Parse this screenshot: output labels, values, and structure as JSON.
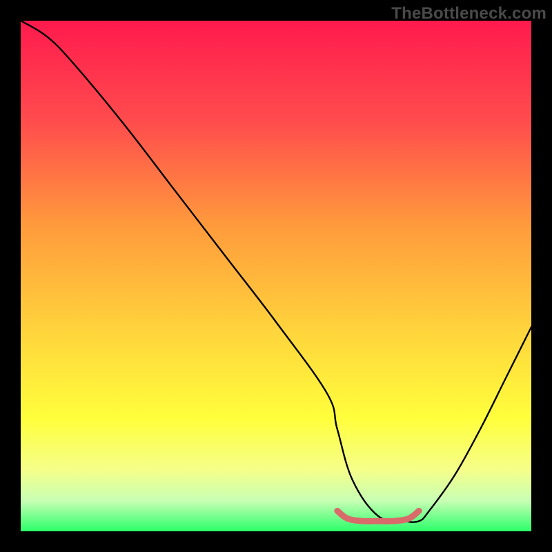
{
  "watermark": "TheBottleneck.com",
  "chart_data": {
    "type": "line",
    "title": "",
    "xlabel": "",
    "ylabel": "",
    "xlim": [
      0,
      100
    ],
    "ylim": [
      0,
      100
    ],
    "grid": false,
    "series": [
      {
        "name": "bottleneck-curve",
        "color": "#000000",
        "x": [
          0,
          5,
          10,
          20,
          30,
          40,
          50,
          60,
          62,
          65,
          70,
          75,
          78,
          80,
          85,
          90,
          95,
          100
        ],
        "y": [
          100,
          97,
          92,
          80,
          67,
          54,
          41,
          27,
          20,
          10,
          3,
          2,
          2,
          4,
          11,
          20,
          30,
          40
        ]
      },
      {
        "name": "optimal-band-marker",
        "color": "#d96b6b",
        "x": [
          62,
          64,
          67,
          70,
          73,
          76,
          78
        ],
        "y": [
          4,
          2.5,
          2,
          2,
          2,
          2.5,
          4
        ]
      }
    ],
    "gradient_stops": [
      {
        "offset": 0.0,
        "color": "#ff1a4d"
      },
      {
        "offset": 0.2,
        "color": "#ff4d4d"
      },
      {
        "offset": 0.4,
        "color": "#ff9a3c"
      },
      {
        "offset": 0.6,
        "color": "#ffd23c"
      },
      {
        "offset": 0.78,
        "color": "#ffff3c"
      },
      {
        "offset": 0.88,
        "color": "#f5ff8a"
      },
      {
        "offset": 0.94,
        "color": "#c8ffb4"
      },
      {
        "offset": 1.0,
        "color": "#2bff6a"
      }
    ]
  }
}
